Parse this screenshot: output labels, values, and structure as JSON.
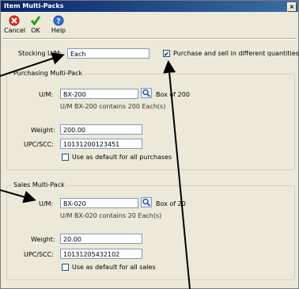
{
  "window": {
    "title": "Item Multi-Packs",
    "close_glyph": "×"
  },
  "toolbar": {
    "cancel_label": "Cancel",
    "ok_label": "OK",
    "help_label": "Help"
  },
  "stocking": {
    "label": "Stocking U/M:",
    "value": "Each",
    "different_checkbox_mark": "✔",
    "different_label": "Purchase and sell in different quantities"
  },
  "purchasing": {
    "group_label": "Purchasing Multi-Pack",
    "um_label": "U/M:",
    "um_value": "BX-200",
    "box_text": "Box of 200",
    "contains_text": "U/M BX-200 contains 200 Each(s)",
    "weight_label": "Weight:",
    "weight_value": "200.00",
    "upc_label": "UPC/SCC:",
    "upc_value": "10131200123451",
    "default_label": "Use as default for all purchases"
  },
  "sales": {
    "group_label": "Sales Multi-Pack",
    "um_label": "U/M:",
    "um_value": "BX-020",
    "box_text": "Box of 20",
    "contains_text": "U/M BX-020 contains 20 Each(s)",
    "weight_label": "Weight:",
    "weight_value": "20.00",
    "upc_label": "UPC/SCC:",
    "upc_value": "10131205432102",
    "default_label": "Use as default for all sales"
  }
}
